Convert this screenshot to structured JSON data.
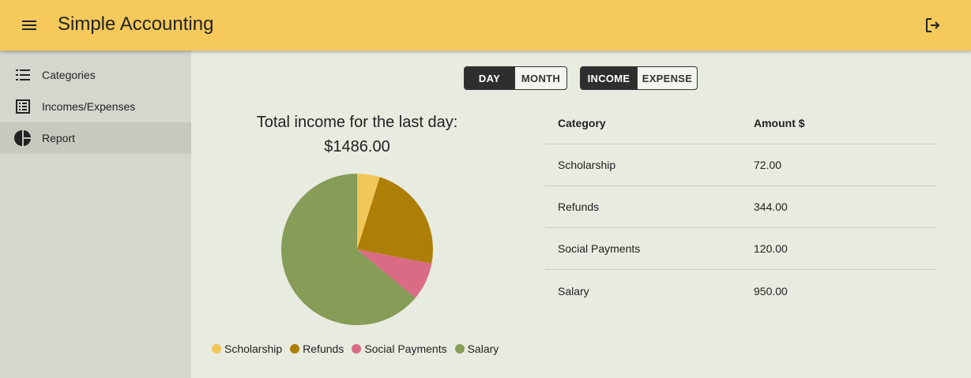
{
  "appbar": {
    "title": "Simple Accounting",
    "menu_icon": "hamburger-menu-icon",
    "logout_icon": "logout-icon"
  },
  "sidebar": {
    "items": [
      {
        "label": "Categories",
        "icon": "list-icon",
        "active": false
      },
      {
        "label": "Incomes/Expenses",
        "icon": "ledger-icon",
        "active": false
      },
      {
        "label": "Report",
        "icon": "pie-chart-icon",
        "active": true
      }
    ]
  },
  "period_toggle": {
    "options": [
      "DAY",
      "MONTH"
    ],
    "selected": "DAY"
  },
  "type_toggle": {
    "options": [
      "INCOME",
      "EXPENSE"
    ],
    "selected": "INCOME"
  },
  "summary": {
    "title": "Total income for the last day:",
    "amount": "$1486.00"
  },
  "table": {
    "headers": [
      "Category",
      "Amount $"
    ],
    "rows": [
      [
        "Scholarship",
        "72.00"
      ],
      [
        "Refunds",
        "344.00"
      ],
      [
        "Social Payments",
        "120.00"
      ],
      [
        "Salary",
        "950.00"
      ]
    ]
  },
  "chart_data": {
    "type": "pie",
    "categories": [
      "Scholarship",
      "Refunds",
      "Social Payments",
      "Salary"
    ],
    "values": [
      72,
      344,
      120,
      950
    ],
    "colors": [
      "#f2c75a",
      "#ae7f06",
      "#d96c84",
      "#869c57"
    ],
    "legend": "bottom"
  },
  "colors": {
    "appbar": "#f5c95a",
    "sidebar": "#d4d7ce",
    "background": "#e8ebe0",
    "toggle_selected": "#2e2e2e"
  }
}
